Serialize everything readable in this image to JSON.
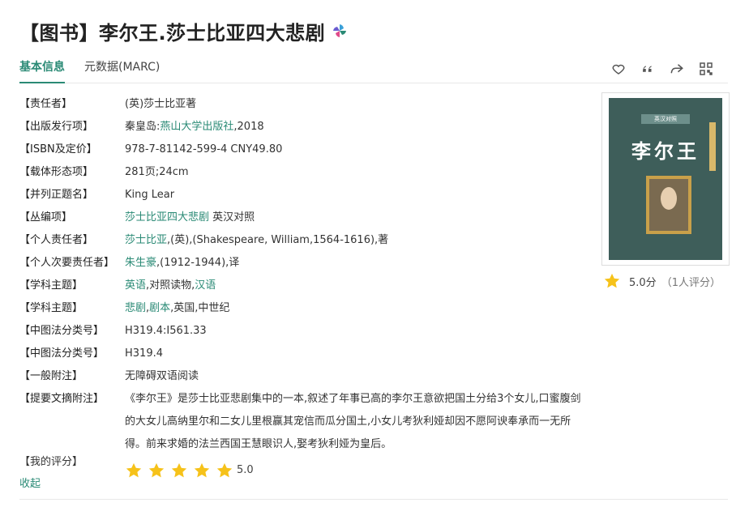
{
  "page": {
    "title": "【图书】李尔王.莎士比亚四大悲剧"
  },
  "tabs": [
    {
      "label": "基本信息",
      "active": true
    },
    {
      "label": "元数据(MARC)",
      "active": false
    }
  ],
  "actions": [
    "heart-icon",
    "quote-icon",
    "share-icon",
    "qrcode-icon"
  ],
  "fields": {
    "responsible": {
      "label": "【责任者】",
      "value": "(英)莎士比亚著"
    },
    "publisher": {
      "label": "【出版发行项】",
      "prefix": "秦皇岛:",
      "link": "燕山大学出版社",
      "suffix": ",2018"
    },
    "isbn": {
      "label": "【ISBN及定价】",
      "value": "978-7-81142-599-4 CNY49.80"
    },
    "physical": {
      "label": "【载体形态项】",
      "value": "281页;24cm"
    },
    "parallel_title": {
      "label": "【并列正题名】",
      "value": "King Lear"
    },
    "series": {
      "label": "【丛编项】",
      "link": "莎士比亚四大悲剧",
      "suffix": " 英汉对照"
    },
    "personal": {
      "label": "【个人责任者】",
      "link": "莎士比亚",
      "suffix": ",(英),(Shakespeare, William,1564-1616),著"
    },
    "secondary": {
      "label": "【个人次要责任者】",
      "link": "朱生豪",
      "suffix": ",(1912-1944),译"
    },
    "subject1": {
      "label": "【学科主题】",
      "link1": "英语",
      "middle": ",对照读物,",
      "link2": "汉语"
    },
    "subject2": {
      "label": "【学科主题】",
      "link1": "悲剧",
      "sep": ",",
      "link2": "剧本",
      "suffix": ",英国,中世纪"
    },
    "clc1": {
      "label": "【中图法分类号】",
      "value": "H319.4:I561.33"
    },
    "clc2": {
      "label": "【中图法分类号】",
      "value": "H319.4"
    },
    "note": {
      "label": "【一般附注】",
      "value": "无障碍双语阅读"
    },
    "abstract": {
      "label": "【提要文摘附注】",
      "value": "《李尔王》是莎士比亚悲剧集中的一本,叙述了年事已高的李尔王意欲把国土分给3个女儿,口蜜腹剑的大女儿高纳里尔和二女儿里根赢其宠信而瓜分国土,小女儿考狄利娅却因不愿阿谀奉承而一无所得。前来求婚的法兰西国王慧眼识人,娶考狄利娅为皇后。"
    }
  },
  "my_rating": {
    "label": "【我的评分】",
    "score": "5.0",
    "stars": 5
  },
  "collapse_label": "收起",
  "book": {
    "cover_series": "英汉对照",
    "cover_title": "李尔王",
    "rating_score": "5.0分",
    "rating_count": "（1人评分）"
  },
  "colors": {
    "accent": "#2a8a75",
    "star": "#f6c21a"
  }
}
